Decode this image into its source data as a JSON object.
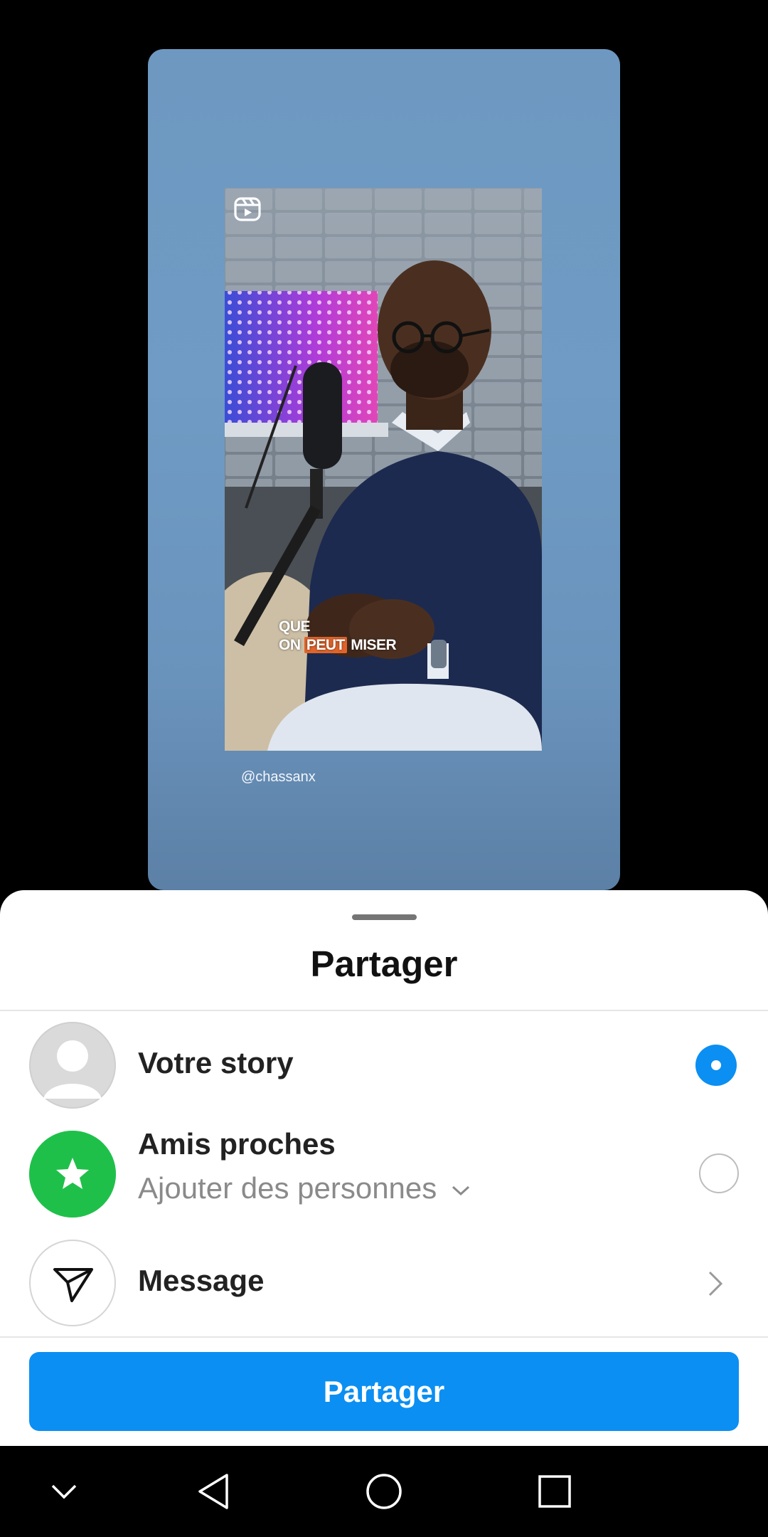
{
  "story_preview": {
    "caption_line1": "QUE",
    "caption_line2_a": "ON",
    "caption_line2_highlight": "PEUT",
    "caption_line2_b": "MISER",
    "handle": "@chassanx",
    "reel_icon": "reels-icon"
  },
  "sheet": {
    "title": "Partager",
    "options": [
      {
        "label": "Votre story",
        "icon": "default-avatar-icon",
        "selected": true
      },
      {
        "label": "Amis proches",
        "sublabel": "Ajouter des personnes",
        "icon": "star-icon",
        "selected": false
      },
      {
        "label": "Message",
        "icon": "paper-plane-icon"
      }
    ],
    "share_button": "Partager"
  },
  "colors": {
    "accent": "#0b8ff2",
    "close_friends_green": "#1fc04a",
    "sheet_bg": "#ffffff"
  },
  "navbar": {
    "icons": [
      "chevron-down-icon",
      "back-triangle-icon",
      "home-circle-icon",
      "recents-square-icon"
    ]
  }
}
